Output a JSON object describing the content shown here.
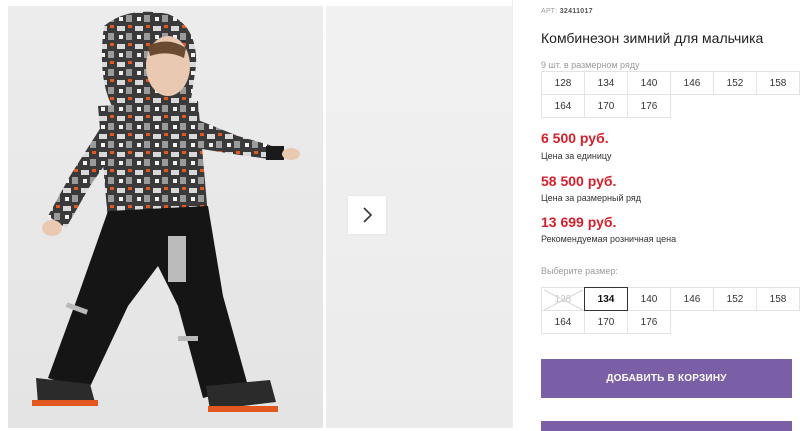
{
  "gallery": {
    "main_image": "boy-winter-snowsuit-photo",
    "next_icon": "chevron-right-icon"
  },
  "product": {
    "article_label": "АРТ:",
    "article_number": "32411017",
    "title": "Комбинезон зимний для мальчика",
    "row_caption": "9 шт. в размерном ряду",
    "row_sizes": [
      "128",
      "134",
      "140",
      "146",
      "152",
      "158",
      "164",
      "170",
      "176"
    ]
  },
  "prices": {
    "unit_price": "6 500 руб.",
    "unit_caption": "Цена за единицу",
    "set_price": "58 500 руб.",
    "set_caption": "Цена за размерный ряд",
    "retail_price": "13 699 руб.",
    "retail_caption": "Рекомендуемая розничная цена",
    "price_color": "#d4202c"
  },
  "size_picker": {
    "label": "Выберите размер:",
    "sizes": [
      "128",
      "134",
      "140",
      "146",
      "152",
      "158",
      "164",
      "170",
      "176"
    ],
    "selected": "134",
    "unavailable": [
      "128"
    ]
  },
  "actions": {
    "add_to_cart": "ДОБАВИТЬ В КОРЗИНУ",
    "accent_color": "#7a5fa6"
  }
}
